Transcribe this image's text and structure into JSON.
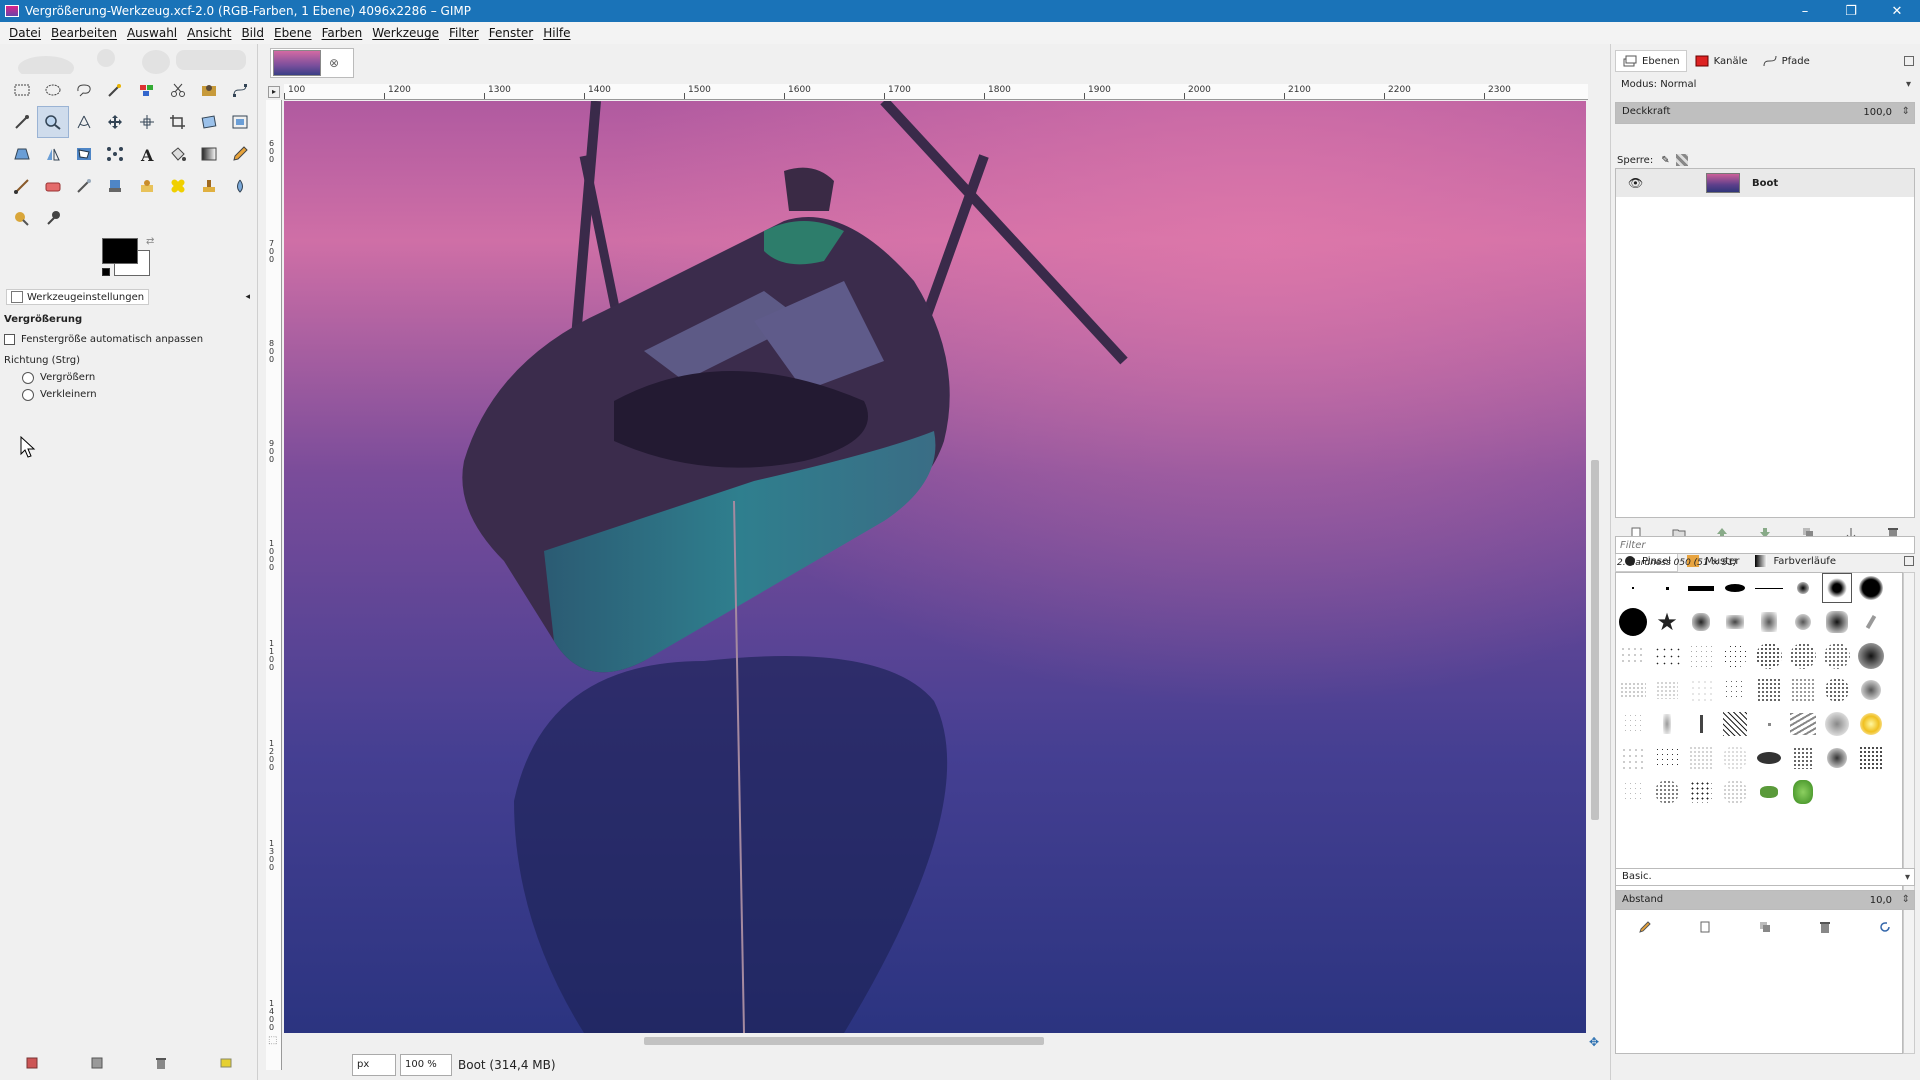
{
  "window": {
    "title": "Vergrößerung-Werkzeug.xcf-2.0 (RGB-Farben, 1 Ebene) 4096x2286 – GIMP",
    "controls": {
      "minimize": "–",
      "maximize": "❐",
      "close": "✕"
    }
  },
  "menu": [
    "Datei",
    "Bearbeiten",
    "Auswahl",
    "Ansicht",
    "Bild",
    "Ebene",
    "Farben",
    "Werkzeuge",
    "Filter",
    "Fenster",
    "Hilfe"
  ],
  "toolbox": {
    "rows": [
      [
        "rect-select",
        "ellipse-select",
        "free-select",
        "fuzzy-select",
        "select-by-color",
        "scissors-select",
        "foreground-select",
        "paths"
      ],
      [
        "color-picker",
        "zoom",
        "measure",
        "move",
        "align",
        "crop",
        "unified-transform",
        "scale"
      ],
      [
        "perspective",
        "flip",
        "cage-transform",
        "warp-transform",
        "text",
        "bucket-fill",
        "gradient",
        "pencil"
      ],
      [
        "paintbrush",
        "eraser",
        "airbrush",
        "ink",
        "mypaint-brush",
        "heal",
        "clone",
        "smudge"
      ],
      [
        "dodge-burn",
        "blur-sharpen"
      ]
    ],
    "active": "zoom"
  },
  "tool_options": {
    "tab_label": "Werkzeugeinstellungen",
    "title": "Vergrößerung",
    "auto_resize_label": "Fenstergröße automatisch anpassen",
    "direction_label": "Richtung (Strg)",
    "zoom_in_label": "Vergrößern",
    "zoom_out_label": "Verkleinern"
  },
  "rulers": {
    "top_labels": [
      "100",
      "1200",
      "1300",
      "1400",
      "1500",
      "1600",
      "1700",
      "1800",
      "1900",
      "2000",
      "2100",
      "2200",
      "2300"
    ],
    "left_labels": [
      "600",
      "700",
      "800",
      "900",
      "1000",
      "1100",
      "1200",
      "1300",
      "1400"
    ]
  },
  "status": {
    "unit": "px",
    "zoom": "100 %",
    "info": "Boot (314,4 MB)"
  },
  "layers_dock": {
    "tabs": [
      "Ebenen",
      "Kanäle",
      "Pfade"
    ],
    "mode_label": "Modus: Normal",
    "opacity_label": "Deckkraft",
    "opacity_value": "100,0",
    "lock_label": "Sperre:",
    "layer_name": "Boot"
  },
  "brushes_dock": {
    "tabs": [
      "Pinsel",
      "Muster",
      "Farbverläufe"
    ],
    "filter_placeholder": "Filter",
    "current_brush": "2. Hardness 050 (51 × 51)",
    "preset": "Basic.",
    "spacing_label": "Abstand",
    "spacing_value": "10,0"
  },
  "colors": {
    "titlebar": "#1a73b8",
    "active_tool": "#cfdcec"
  }
}
